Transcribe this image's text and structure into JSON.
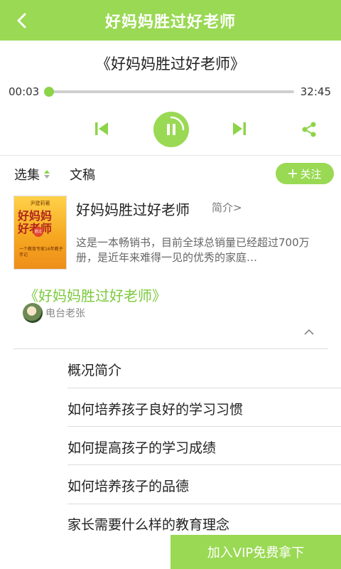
{
  "header": {
    "title": "好妈妈胜过好老师"
  },
  "player": {
    "track_title": "《好妈妈胜过好老师》",
    "current_time": "00:03",
    "total_time": "32:45",
    "progress": 0.002
  },
  "tabs": {
    "select_label": "选集",
    "article_label": "文稿"
  },
  "follow": {
    "label": "关注"
  },
  "book": {
    "cover": {
      "top_text": "尹建莉著",
      "main_text": "好妈妈 好老师",
      "mid_text": "胜过",
      "sub_text": "一个教育专家16年教子手记"
    },
    "title": "好妈妈胜过好老师",
    "intro_link": "简介>",
    "description": "这是一本畅销书，目前全球总销量已经超过700万册，是近年来难得一见的优秀的家庭…"
  },
  "album": {
    "title": "《好妈妈胜过好老师》",
    "author": "电台老张"
  },
  "chapters": [
    "概况简介",
    "如何培养孩子良好的学习习惯",
    "如何提高孩子的学习成绩",
    "如何培养孩子的品德",
    "家长需要什么样的教育理念"
  ],
  "vip_button": {
    "label": "加入VIP免费拿下"
  },
  "colors": {
    "accent": "#9ad954",
    "accent_text": "#7bc93c"
  }
}
